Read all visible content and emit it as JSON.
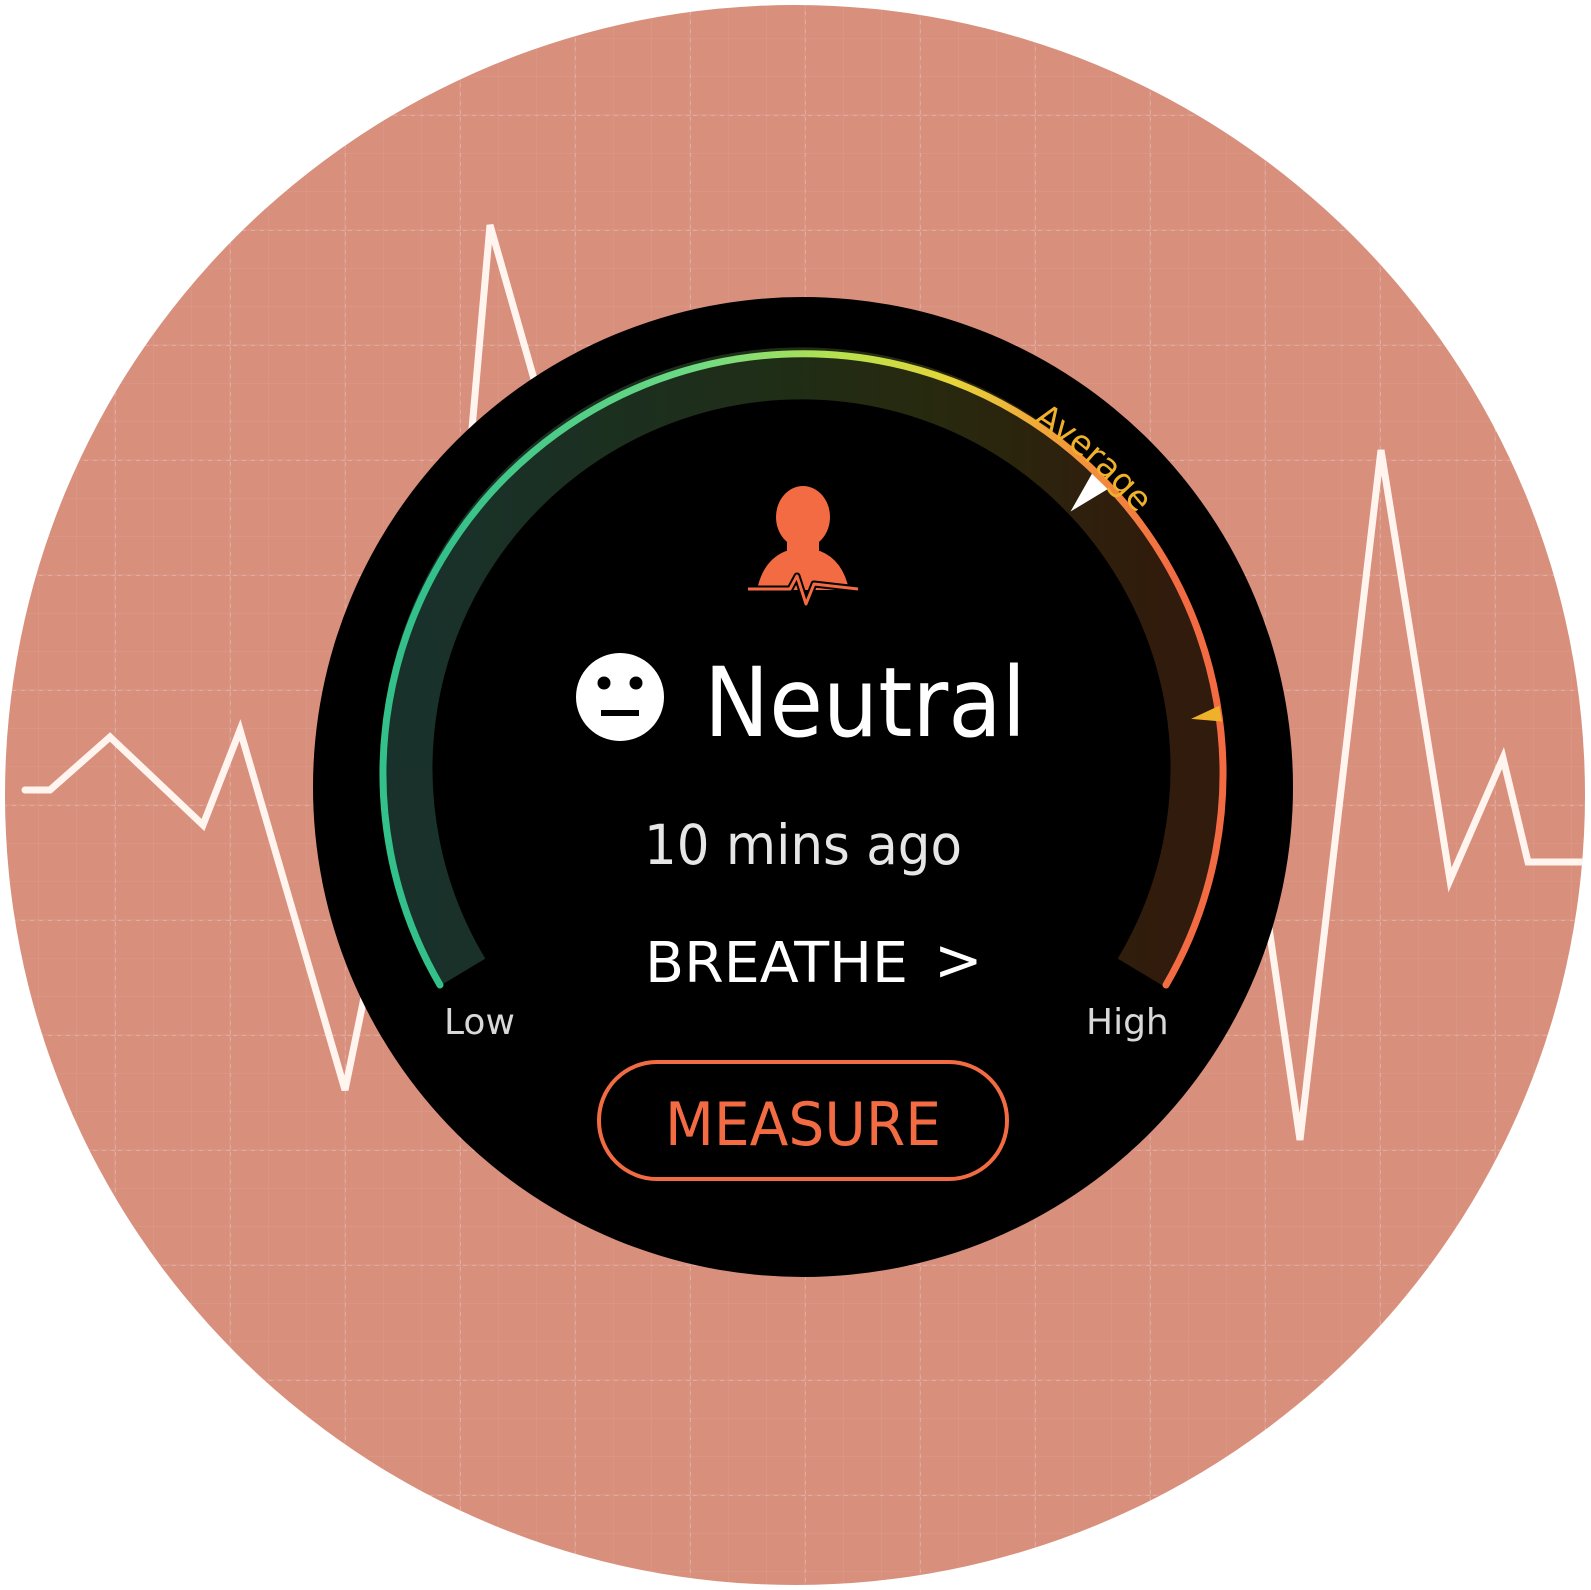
{
  "screen": {
    "status": "Neutral",
    "time_since": "10 mins ago",
    "breathe_label": "BREATHE",
    "breathe_chevron": ">",
    "measure_label": "MEASURE"
  },
  "gauge": {
    "low_label": "Low",
    "high_label": "High",
    "average_label": "Average",
    "current_level": 0.66,
    "average_level": 0.79
  },
  "icons": {
    "status_face": "neutral-face-icon",
    "stress_person": "person-heartbeat-icon",
    "average_marker": "triangle-marker-icon",
    "current_marker": "white-triangle-pointer-icon"
  },
  "colors": {
    "background_circle": "#D88F7C",
    "watch_face": "#000000",
    "accent_orange": "#F26B43",
    "average_text": "#F0B12A",
    "gauge_green": "#2ECB93",
    "gauge_yellow": "#E7D63A",
    "gauge_orange": "#F26B43"
  }
}
